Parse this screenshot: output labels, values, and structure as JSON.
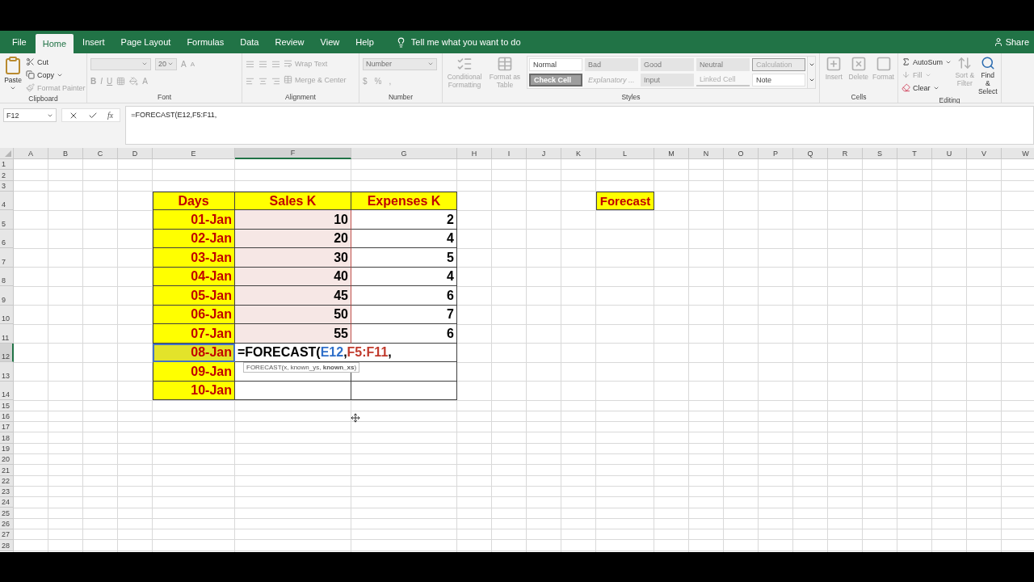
{
  "ribbon_tabs": [
    {
      "label": "File",
      "selected": false
    },
    {
      "label": "Home",
      "selected": true
    },
    {
      "label": "Insert",
      "selected": false
    },
    {
      "label": "Page Layout",
      "selected": false
    },
    {
      "label": "Formulas",
      "selected": false
    },
    {
      "label": "Data",
      "selected": false
    },
    {
      "label": "Review",
      "selected": false
    },
    {
      "label": "View",
      "selected": false
    },
    {
      "label": "Help",
      "selected": false
    }
  ],
  "tell_me": "Tell me what you want to do",
  "share": "Share",
  "clipboard": {
    "title": "Clipboard",
    "paste": {
      "label": "Paste",
      "disabled": false
    },
    "commands": [
      {
        "label": "Cut",
        "kind": "cut",
        "disabled": false
      },
      {
        "label": "Copy",
        "kind": "copy",
        "disabled": false
      },
      {
        "label": "Format Painter",
        "kind": "painter",
        "disabled": true
      }
    ]
  },
  "font": {
    "title": "Font",
    "size": "20",
    "grow": "A",
    "shrink": "A",
    "styles": [
      "B",
      "I",
      "U"
    ],
    "color_button": "A",
    "disabled": true
  },
  "alignment": {
    "title": "Alignment",
    "commands": [
      {
        "label": "Wrap Text",
        "kind": "wrap",
        "disabled": true
      },
      {
        "label": "Merge & Center",
        "kind": "merge",
        "disabled": true
      }
    ],
    "disabled": true
  },
  "number": {
    "title": "Number",
    "format": "Number",
    "symbols": [
      "$",
      "%",
      ","
    ],
    "disabled": true
  },
  "styles": {
    "title": "Styles",
    "commands": [
      {
        "label": "Conditional Formatting",
        "kind": "conditional",
        "disabled": true
      },
      {
        "label": "Format as Table",
        "kind": "table",
        "disabled": true
      }
    ],
    "cell_styles": [
      {
        "label": "Normal",
        "kind": "plain"
      },
      {
        "label": "Bad",
        "kind": "shaded"
      },
      {
        "label": "Good",
        "kind": "shaded"
      },
      {
        "label": "Neutral",
        "kind": "shaded"
      },
      {
        "label": "Calculation",
        "kind": "outlined"
      },
      {
        "label": "Check Cell",
        "kind": "dark"
      },
      {
        "label": "Explanatory ...",
        "kind": "italic"
      },
      {
        "label": "Input",
        "kind": "shaded"
      },
      {
        "label": "Linked Cell",
        "kind": "underlined"
      },
      {
        "label": "Note",
        "kind": "plain"
      }
    ]
  },
  "cells": {
    "title": "Cells",
    "commands": [
      {
        "label": "Insert",
        "kind": "insert",
        "disabled": true
      },
      {
        "label": "Delete",
        "kind": "delete",
        "disabled": true
      },
      {
        "label": "Format",
        "kind": "format",
        "disabled": true
      }
    ]
  },
  "editing": {
    "title": "Editing",
    "commands": [
      {
        "label": "AutoSum",
        "kind": "sum",
        "disabled": false
      },
      {
        "label": "Fill",
        "kind": "fill",
        "disabled": true
      },
      {
        "label": "Clear",
        "kind": "clear",
        "disabled": false
      }
    ],
    "big_commands": [
      {
        "label": "Sort & Filter",
        "kind": "sort",
        "disabled": true
      },
      {
        "label": "Find & Select",
        "kind": "find",
        "disabled": false
      }
    ]
  },
  "formula_bar": {
    "name_box": "F12",
    "fx": "fx",
    "formula": "=FORECAST(E12,F5:F11,"
  },
  "columns": [
    {
      "label": "A",
      "selected": false
    },
    {
      "label": "B",
      "selected": false
    },
    {
      "label": "C",
      "selected": false
    },
    {
      "label": "D",
      "selected": false
    },
    {
      "label": "E",
      "selected": false
    },
    {
      "label": "F",
      "selected": true
    },
    {
      "label": "G",
      "selected": false
    },
    {
      "label": "H",
      "selected": false
    },
    {
      "label": "I",
      "selected": false
    },
    {
      "label": "J",
      "selected": false
    },
    {
      "label": "K",
      "selected": false
    },
    {
      "label": "L",
      "selected": false
    },
    {
      "label": "M",
      "selected": false
    },
    {
      "label": "N",
      "selected": false
    },
    {
      "label": "O",
      "selected": false
    },
    {
      "label": "P",
      "selected": false
    },
    {
      "label": "Q",
      "selected": false
    },
    {
      "label": "R",
      "selected": false
    },
    {
      "label": "S",
      "selected": false
    },
    {
      "label": "T",
      "selected": false
    },
    {
      "label": "U",
      "selected": false
    },
    {
      "label": "V",
      "selected": false
    },
    {
      "label": "W",
      "selected": false
    }
  ],
  "row_numbers": [
    {
      "label": "1",
      "selected": false
    },
    {
      "label": "2",
      "selected": false
    },
    {
      "label": "3",
      "selected": false
    },
    {
      "label": "4",
      "selected": false
    },
    {
      "label": "5",
      "selected": false
    },
    {
      "label": "6",
      "selected": false
    },
    {
      "label": "7",
      "selected": false
    },
    {
      "label": "8",
      "selected": false
    },
    {
      "label": "9",
      "selected": false
    },
    {
      "label": "10",
      "selected": false
    },
    {
      "label": "11",
      "selected": false
    },
    {
      "label": "12",
      "selected": true
    },
    {
      "label": "13",
      "selected": false
    },
    {
      "label": "14",
      "selected": false
    },
    {
      "label": "15",
      "selected": false
    },
    {
      "label": "16",
      "selected": false
    },
    {
      "label": "17",
      "selected": false
    },
    {
      "label": "18",
      "selected": false
    },
    {
      "label": "19",
      "selected": false
    },
    {
      "label": "20",
      "selected": false
    },
    {
      "label": "21",
      "selected": false
    },
    {
      "label": "22",
      "selected": false
    },
    {
      "label": "23",
      "selected": false
    },
    {
      "label": "24",
      "selected": false
    },
    {
      "label": "25",
      "selected": false
    },
    {
      "label": "26",
      "selected": false
    },
    {
      "label": "27",
      "selected": false
    },
    {
      "label": "28",
      "selected": false
    }
  ],
  "data_table": {
    "headers": [
      "Days",
      "Sales K",
      "Expenses K"
    ],
    "rows": [
      {
        "day": "01-Jan",
        "day_referenced": false,
        "sales": "10",
        "sales_referenced": true,
        "expenses": "2"
      },
      {
        "day": "02-Jan",
        "day_referenced": false,
        "sales": "20",
        "sales_referenced": true,
        "expenses": "4"
      },
      {
        "day": "03-Jan",
        "day_referenced": false,
        "sales": "30",
        "sales_referenced": true,
        "expenses": "5"
      },
      {
        "day": "04-Jan",
        "day_referenced": false,
        "sales": "40",
        "sales_referenced": true,
        "expenses": "4"
      },
      {
        "day": "05-Jan",
        "day_referenced": false,
        "sales": "45",
        "sales_referenced": true,
        "expenses": "6"
      },
      {
        "day": "06-Jan",
        "day_referenced": false,
        "sales": "50",
        "sales_referenced": true,
        "expenses": "7"
      },
      {
        "day": "07-Jan",
        "day_referenced": false,
        "sales": "55",
        "sales_referenced": true,
        "expenses": "6"
      },
      {
        "day": "08-Jan",
        "day_referenced": true,
        "formula": {
          "parts": [
            {
              "text": "=FORECAST(",
              "color": "#000000"
            },
            {
              "text": "E12",
              "color": "#2f6fc9"
            },
            {
              "text": ",",
              "color": "#000000"
            },
            {
              "text": "F5:F11",
              "color": "#c0392b"
            },
            {
              "text": ",",
              "color": "#000000"
            }
          ],
          "tooltip": "FORECAST(x, known_ys, **known_xs**)"
        }
      },
      {
        "day": "09-Jan",
        "day_referenced": false
      },
      {
        "day": "10-Jan",
        "day_referenced": false
      }
    ]
  },
  "forecast_label": "Forecast"
}
